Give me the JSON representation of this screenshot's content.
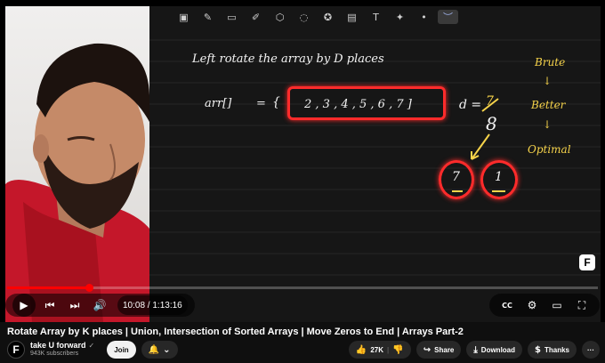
{
  "toolbar": {
    "icons": [
      "image-icon",
      "pen-icon",
      "eraser-icon",
      "highlighter-icon",
      "shapes-icon",
      "lasso-icon",
      "star-icon",
      "insert-image-icon",
      "text-icon",
      "laser-pointer-icon",
      "dot-icon",
      "line-icon"
    ],
    "glyphs": [
      "▣",
      "✎",
      "▭",
      "✐",
      "⬡",
      "◌",
      "✪",
      "▤",
      "T",
      "✦",
      "•",
      "︶"
    ]
  },
  "board": {
    "heading": "Left rotate the array by D places",
    "array_label": "arr[]",
    "equals": "=",
    "open_brace": "{",
    "array_values": "2 , 3 , 4 , 5 , 6 , 7 ]",
    "d_label": "d =",
    "d_old": "7",
    "d_new": "8",
    "circle_left": "7",
    "circle_right": "1",
    "approaches": [
      "Brute",
      "↓",
      "Better",
      "↓",
      "Optimal"
    ]
  },
  "player": {
    "current_time": "10:08",
    "duration": "1:13:16",
    "time_display": "10:08 / 1:13:16",
    "progress_fraction": 0.138,
    "play_icon": "▶",
    "prev_icon": "⏮",
    "next_icon": "⏭",
    "volume_icon": "🔊",
    "right_icons": [
      "CC",
      "⚙",
      "▭",
      "⛶"
    ]
  },
  "video": {
    "title": "Rotate Array by K places | Union, Intersection of Sorted Arrays | Move Zeros to End | Arrays Part-2"
  },
  "channel": {
    "avatar_letter": "F",
    "name": "take U forward",
    "verified": "✓",
    "subscribers": "943K subscribers",
    "join_label": "Join",
    "subscribe_icon": "🔔"
  },
  "actions": {
    "likes": "27K",
    "share": "Share",
    "download": "Download",
    "thanks": "Thanks",
    "more": "···"
  },
  "colors": {
    "accent": "#ff0000",
    "annotation": "#ff2b2b",
    "highlight": "#f6d34a",
    "board": "#161616"
  }
}
